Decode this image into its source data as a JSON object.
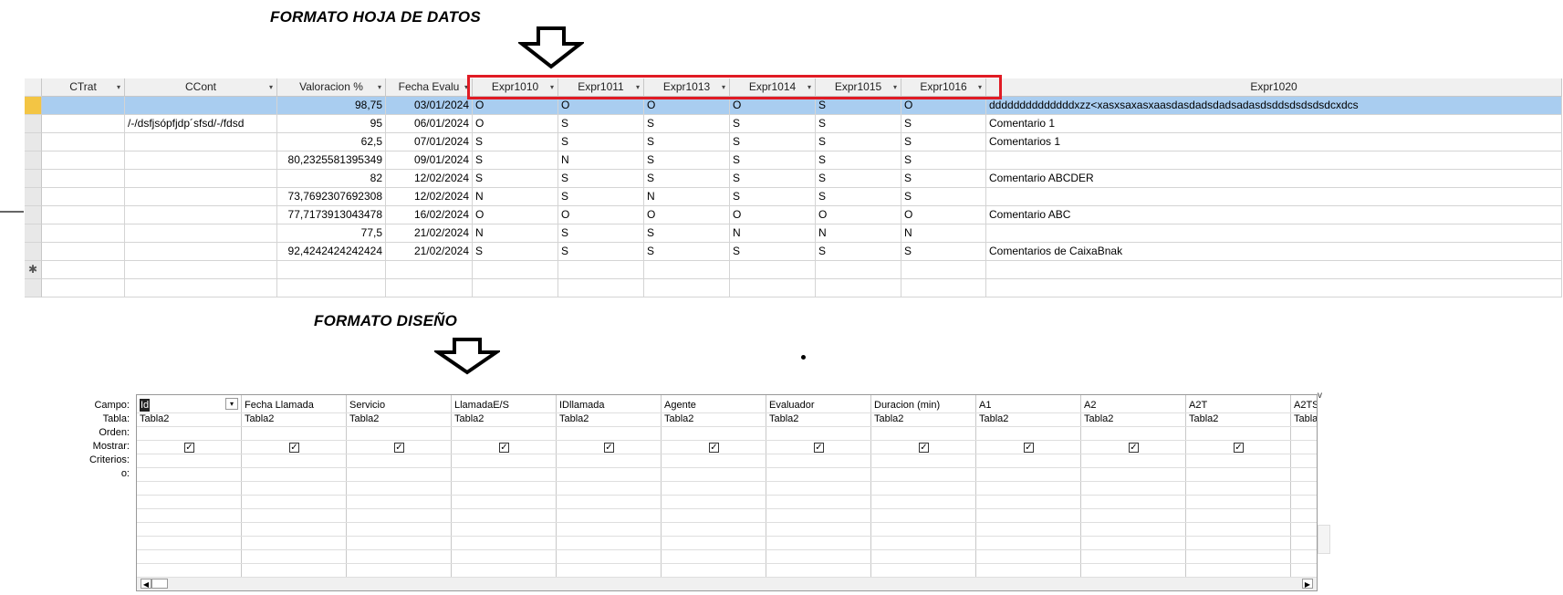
{
  "headings": {
    "datasheet": "FORMATO HOJA DE DATOS",
    "design": "FORMATO DISEÑO"
  },
  "datasheet": {
    "columns": [
      "CTrat",
      "CCont",
      "Valoracion %",
      "Fecha Evalu",
      "Expr1010",
      "Expr1011",
      "Expr1013",
      "Expr1014",
      "Expr1015",
      "Expr1016",
      "Expr1020"
    ],
    "rows": [
      [
        "",
        "",
        "98,75",
        "03/01/2024",
        "O",
        "O",
        "O",
        "O",
        "S",
        "O",
        "ddddddddddddddxzz<xasxsaxasxaasdasdadsdadsadasdsddsdsdsdsdcxdcs"
      ],
      [
        "",
        "/-/dsfjsópfjdp´sfsd/-/fdsd",
        "95",
        "06/01/2024",
        "O",
        "S",
        "S",
        "S",
        "S",
        "S",
        "Comentario 1"
      ],
      [
        "",
        "",
        "62,5",
        "07/01/2024",
        "S",
        "S",
        "S",
        "S",
        "S",
        "S",
        "Comentarios 1"
      ],
      [
        "",
        "",
        "80,2325581395349",
        "09/01/2024",
        "S",
        "N",
        "S",
        "S",
        "S",
        "S",
        ""
      ],
      [
        "",
        "",
        "82",
        "12/02/2024",
        "S",
        "S",
        "S",
        "S",
        "S",
        "S",
        "Comentario ABCDER"
      ],
      [
        "",
        "",
        "73,7692307692308",
        "12/02/2024",
        "N",
        "S",
        "N",
        "S",
        "S",
        "S",
        ""
      ],
      [
        "",
        "",
        "77,7173913043478",
        "16/02/2024",
        "O",
        "O",
        "O",
        "O",
        "O",
        "O",
        "Comentario ABC"
      ],
      [
        "",
        "",
        "77,5",
        "21/02/2024",
        "N",
        "S",
        "S",
        "N",
        "N",
        "N",
        ""
      ],
      [
        "",
        "",
        "92,4242424242424",
        "21/02/2024",
        "S",
        "S",
        "S",
        "S",
        "S",
        "S",
        "Comentarios de CaixaBnak"
      ]
    ],
    "new_row_marker": "✱"
  },
  "design": {
    "row_labels": [
      "Campo:",
      "Tabla:",
      "Orden:",
      "Mostrar:",
      "Criterios:",
      "o:"
    ],
    "fields": [
      {
        "campo": "Id",
        "tabla": "Tabla2"
      },
      {
        "campo": "Fecha Llamada",
        "tabla": "Tabla2"
      },
      {
        "campo": "Servicio",
        "tabla": "Tabla2"
      },
      {
        "campo": "LlamadaE/S",
        "tabla": "Tabla2"
      },
      {
        "campo": "IDllamada",
        "tabla": "Tabla2"
      },
      {
        "campo": "Agente",
        "tabla": "Tabla2"
      },
      {
        "campo": "Evaluador",
        "tabla": "Tabla2"
      },
      {
        "campo": "Duracion (min)",
        "tabla": "Tabla2"
      },
      {
        "campo": "A1",
        "tabla": "Tabla2"
      },
      {
        "campo": "A2",
        "tabla": "Tabla2"
      },
      {
        "campo": "A2T",
        "tabla": "Tabla2"
      },
      {
        "campo": "A2TS",
        "tabla": "Tabla"
      }
    ],
    "mostrar_checked": true
  }
}
